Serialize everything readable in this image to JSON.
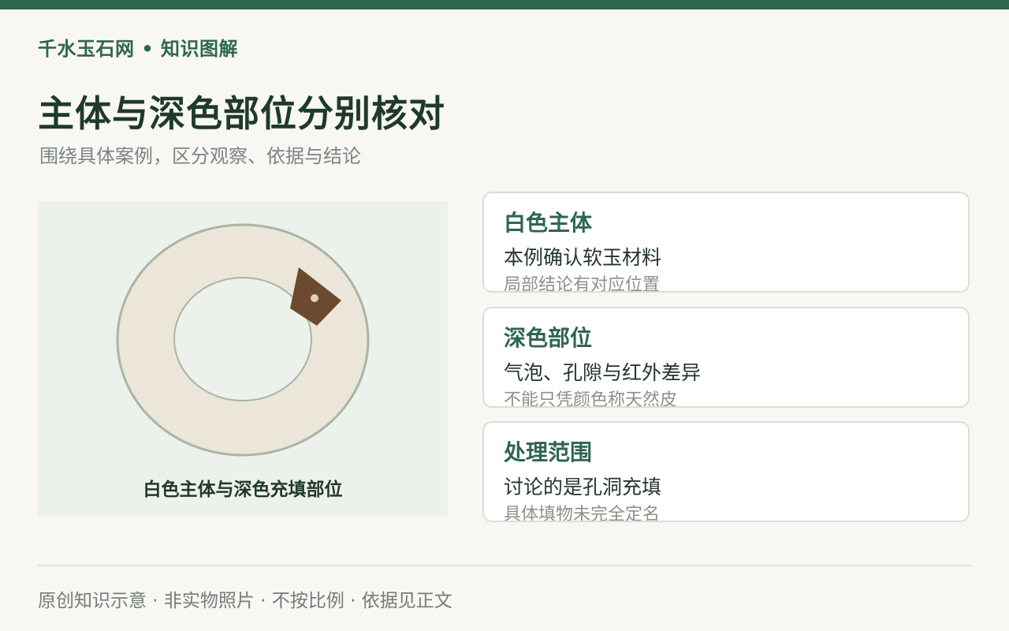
{
  "brand": "千水玉石网 • 知识图解",
  "title": "主体与深色部位分别核对",
  "subtitle": "围绕具体案例，区分观察、依据与结论",
  "figure": {
    "caption": "白色主体与深色充填部位",
    "colors": {
      "panel": "#edf1ec",
      "ring_fill": "#ebe6d9",
      "ring_stroke": "#a8b5a4",
      "dark_patch": "#6b4a30",
      "patch_dot": "#e2d2b8"
    }
  },
  "cards": [
    {
      "title": "白色主体",
      "main": "本例确认软玉材料",
      "note": "局部结论有对应位置"
    },
    {
      "title": "深色部位",
      "main": "气泡、孔隙与红外差异",
      "note": "不能只凭颜色称天然皮"
    },
    {
      "title": "处理范围",
      "main": "讨论的是孔洞充填",
      "note": "具体填物未完全定名"
    }
  ],
  "footer": "原创知识示意 · 非实物照片 · 不按比例 · 依据见正文",
  "colors": {
    "accent": "#2f6651",
    "title": "#1f3a2b",
    "background": "#f8f7f3"
  }
}
